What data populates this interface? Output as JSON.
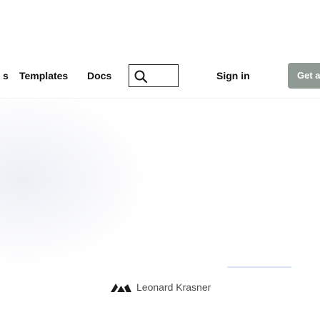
{
  "nav": {
    "cut_item": "s",
    "templates": "Templates",
    "docs": "Docs",
    "sign_in": "Sign in",
    "get_all": "Get all"
  },
  "search": {
    "icon": "search-icon"
  },
  "author": {
    "name": "Leonard Krasner",
    "icon": "logo-icon"
  },
  "colors": {
    "accent_button": "#8f9a93",
    "text": "#111111",
    "underline": "#d9e5f5"
  }
}
